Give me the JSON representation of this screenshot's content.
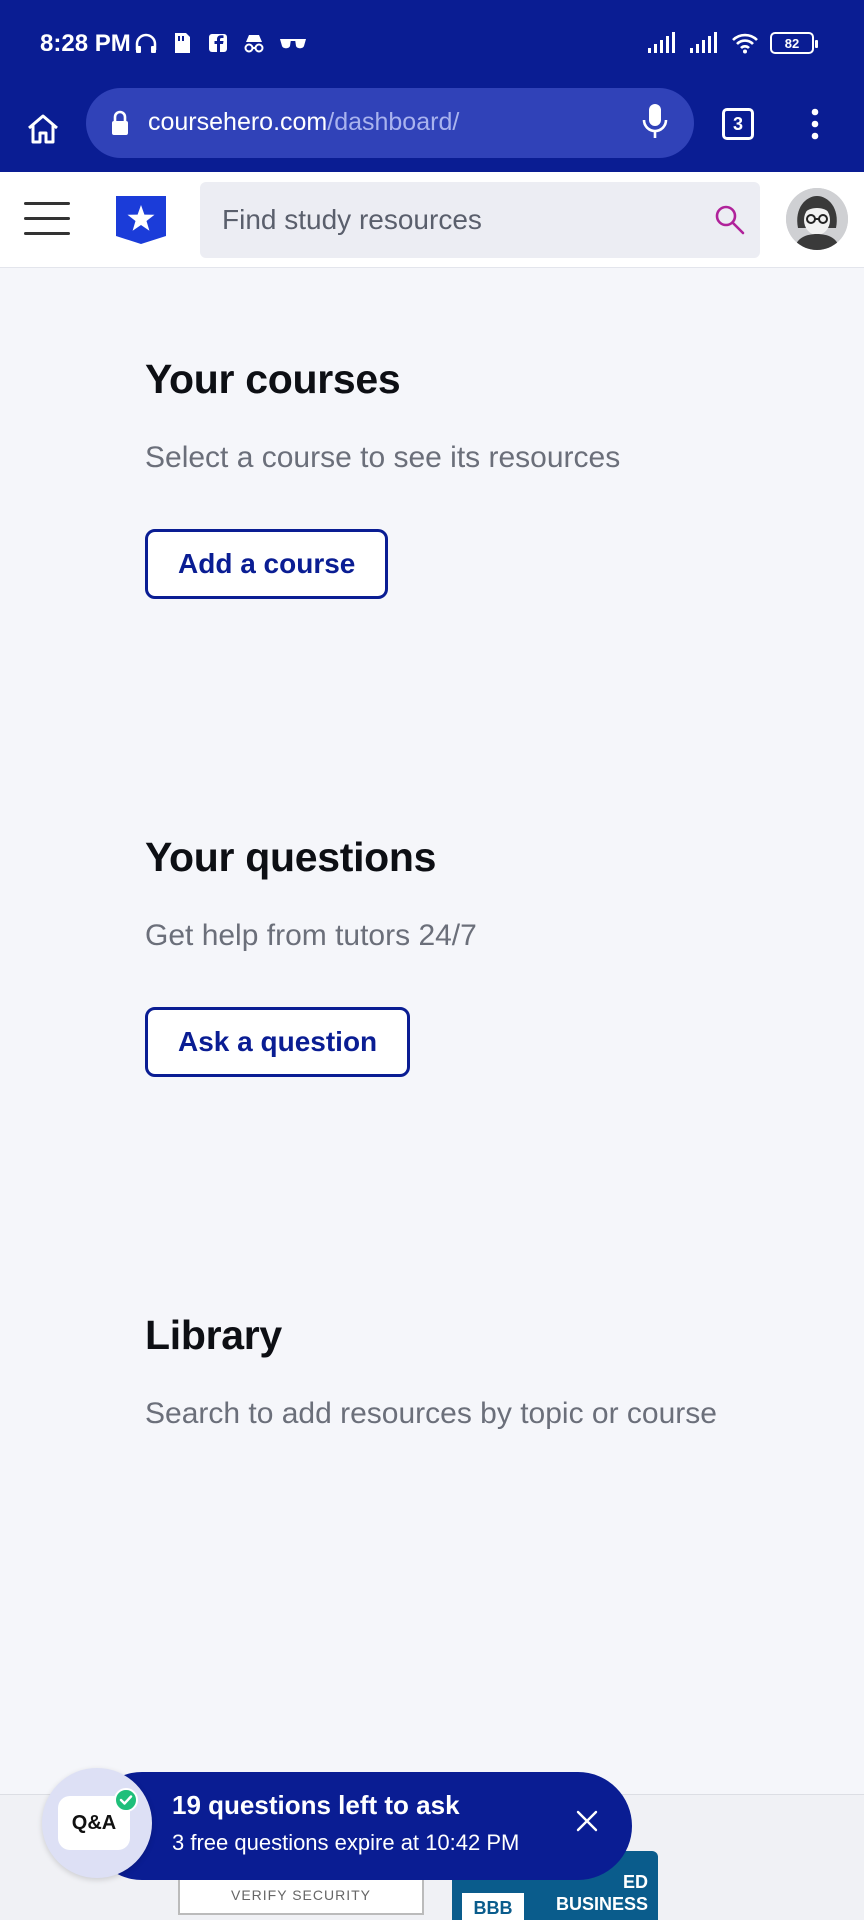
{
  "status_bar": {
    "time": "8:28 PM",
    "battery": "82",
    "icons_left": [
      "headphones-icon",
      "sd-card-icon",
      "facebook-icon",
      "incognito-icon",
      "glasses-icon"
    ],
    "icons_right": [
      "signal-icon",
      "signal-icon",
      "wifi-icon",
      "battery-icon"
    ]
  },
  "browser": {
    "url_domain": "coursehero.com",
    "url_path": "/dashboard/",
    "tab_count": "3"
  },
  "header": {
    "search_placeholder": "Find study resources"
  },
  "sections": {
    "courses": {
      "title": "Your courses",
      "subtitle": "Select a course to see its resources",
      "button": "Add a course"
    },
    "questions": {
      "title": "Your questions",
      "subtitle": "Get help from tutors 24/7",
      "button": "Ask a question"
    },
    "library": {
      "title": "Library",
      "subtitle": "Search to add resources by topic or course"
    }
  },
  "qa_banner": {
    "bubble_label": "Q&A",
    "title": "19 questions left to ask",
    "subtitle": "3 free questions expire at 10:42 PM"
  },
  "footer": {
    "verify_label": "VERIFY SECURITY",
    "bbb_logo": "BBB",
    "bbb_text": "ED\nBUSINESS"
  },
  "colors": {
    "brand_navy": "#0a1d93",
    "url_bar": "#3042b8",
    "page_bg": "#f5f6fa",
    "search_icon": "#b0229a"
  }
}
